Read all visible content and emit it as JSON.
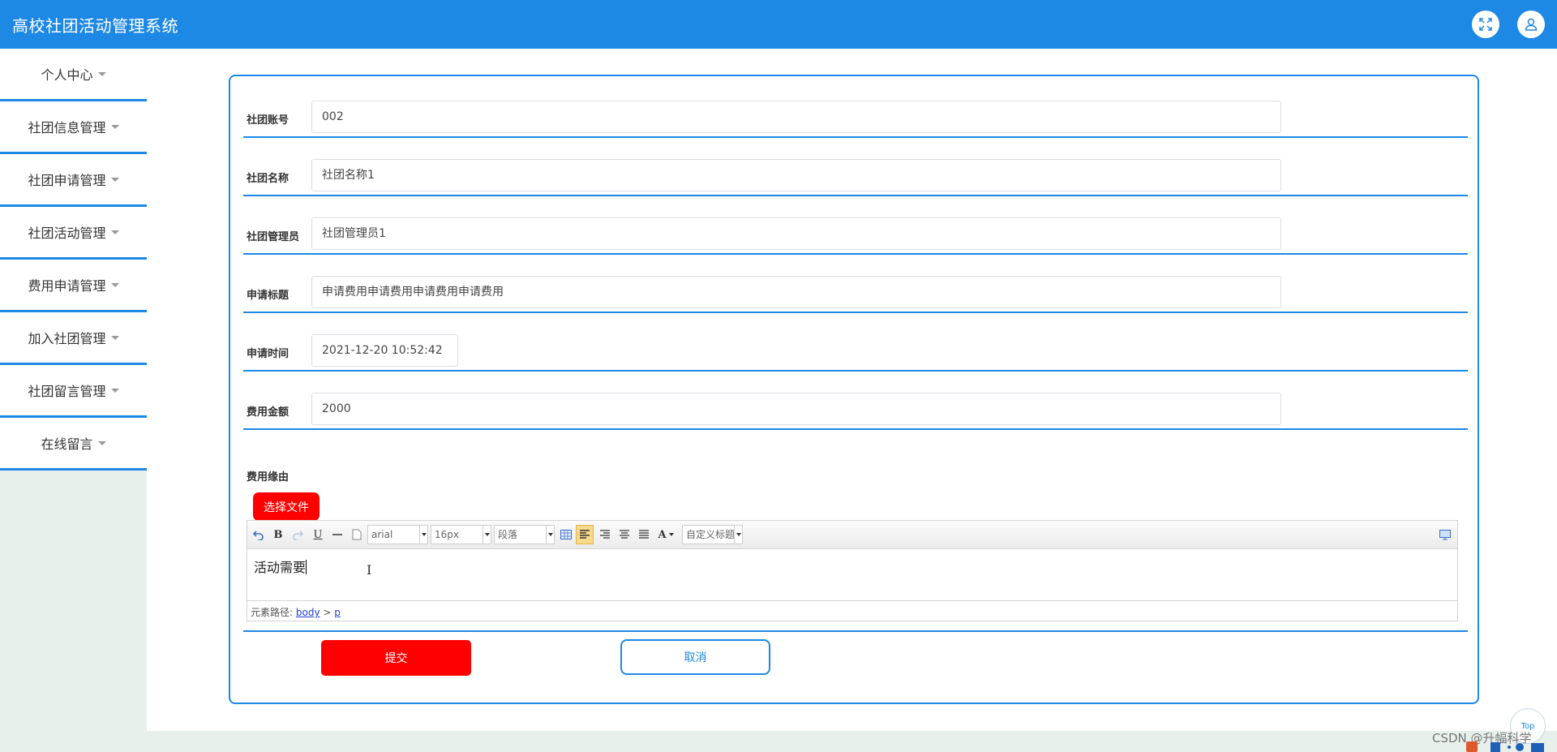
{
  "header": {
    "app_title": "高校社团活动管理系统",
    "fullscreen_icon": "fullscreen-icon",
    "user_icon": "user-icon",
    "color": "#1e88e5"
  },
  "sidebar": {
    "items": [
      {
        "label": "个人中心"
      },
      {
        "label": "社团信息管理"
      },
      {
        "label": "社团申请管理"
      },
      {
        "label": "社团活动管理"
      },
      {
        "label": "费用申请管理"
      },
      {
        "label": "加入社团管理"
      },
      {
        "label": "社团留言管理"
      },
      {
        "label": "在线留言"
      }
    ]
  },
  "form": {
    "club_account": {
      "label": "社团账号",
      "value": "002"
    },
    "club_name": {
      "label": "社团名称",
      "value": "社团名称1"
    },
    "club_admin": {
      "label": "社团管理员",
      "value": "社团管理员1"
    },
    "apply_title": {
      "label": "申请标题",
      "value": "申请费用申请费用申请费用申请费用"
    },
    "apply_time": {
      "label": "申请时间",
      "value": "2021-12-20 10:52:42"
    },
    "amount": {
      "label": "费用金额",
      "value": "2000"
    },
    "reason": {
      "label": "费用缘由"
    },
    "file_button": "选择文件",
    "submit_button": "提交",
    "cancel_button": "取消"
  },
  "editor": {
    "toolbar": {
      "bold": "B",
      "underline": "U",
      "font_family": "arial",
      "font_size": "16px",
      "paragraph": "段落",
      "font_color": "A",
      "custom_heading": "自定义标题"
    },
    "content": "活动需要",
    "path_label": "元素路径:",
    "path_body": "body",
    "path_sep": " > ",
    "path_p": "p"
  },
  "misc": {
    "top_button": "Top",
    "watermark": "CSDN @升幅科学"
  }
}
